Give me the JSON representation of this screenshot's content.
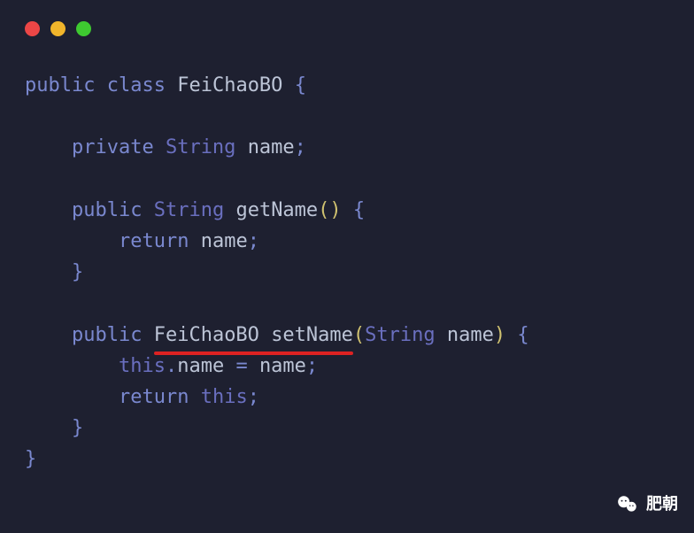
{
  "window": {
    "dots": [
      "red",
      "yellow",
      "green"
    ]
  },
  "code": {
    "kw_public": "public",
    "kw_class": "class",
    "kw_private": "private",
    "kw_return": "return",
    "kw_this": "this",
    "type_string": "String",
    "class_name": "FeiChaoBO",
    "field_name": "name",
    "method_get": "getName",
    "method_set": "setName",
    "param_name": "name",
    "semi": ";",
    "lbrace": "{",
    "rbrace": "}",
    "lparen": "(",
    "rparen": ")",
    "dot": ".",
    "eq": "=",
    "sp": " "
  },
  "watermark": {
    "text": "肥朝"
  }
}
